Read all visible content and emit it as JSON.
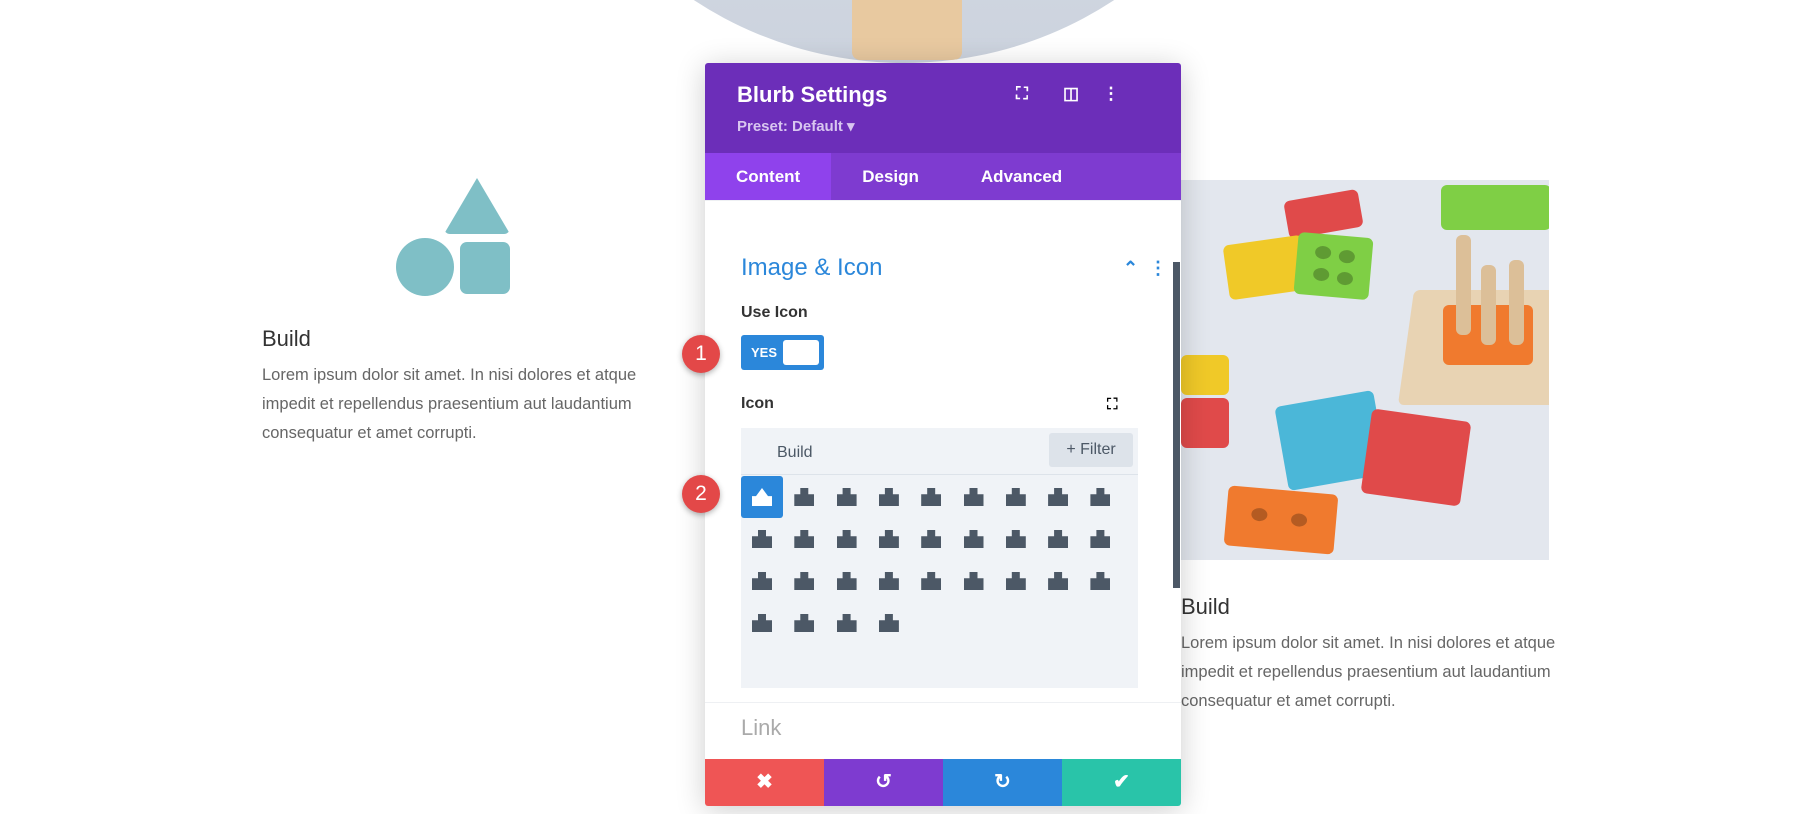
{
  "left_blurb": {
    "title": "Build",
    "text": "Lorem ipsum dolor sit amet. In nisi dolores et atque impedit et repellendus praesentium aut laudantium consequatur et amet corrupti."
  },
  "right_blurb": {
    "title": "Build",
    "text": "Lorem ipsum dolor sit amet. In nisi dolores et atque impedit et repellendus praesentium aut laudantium consequatur et amet corrupti."
  },
  "panel": {
    "title": "Blurb Settings",
    "preset": "Preset: Default ▾",
    "header_icons": [
      "focus-icon",
      "split-view-icon",
      "more-icon"
    ],
    "tabs": [
      {
        "label": "Content",
        "active": true
      },
      {
        "label": "Design"
      },
      {
        "label": "Advanced"
      }
    ],
    "section_title": "Image & Icon",
    "use_icon_label": "Use Icon",
    "toggle_value": "YES",
    "icon_label": "Icon",
    "search_value": "Build",
    "filter_label": "+ Filter",
    "icons": [
      "shapes",
      "city",
      "city-alt",
      "building",
      "building-outline",
      "buildings",
      "kaaba",
      "store",
      "hotel",
      "mosque",
      "place-of-worship",
      "church",
      "gopuram",
      "monument",
      "landmark",
      "hospital",
      "hospital-alt",
      "industry",
      "warehouse",
      "synagogue",
      "home",
      "university",
      "vihara",
      "torii-gate",
      "store-slash",
      "pagoda",
      "shop",
      "house-user",
      "school",
      "church-alt",
      "shop-slash"
    ],
    "next_section": "Link",
    "footer": {
      "cancel": "✖",
      "undo": "↺",
      "redo": "↻",
      "save": "✔"
    },
    "colors": {
      "header": "#6c2eb9",
      "tabs": "#7e3bd0",
      "accent": "#2b87da",
      "cancel": "#ef5555",
      "undo": "#7e3bd0",
      "redo": "#2b87da",
      "save": "#29c4a9"
    }
  },
  "badges": [
    "1",
    "2"
  ]
}
